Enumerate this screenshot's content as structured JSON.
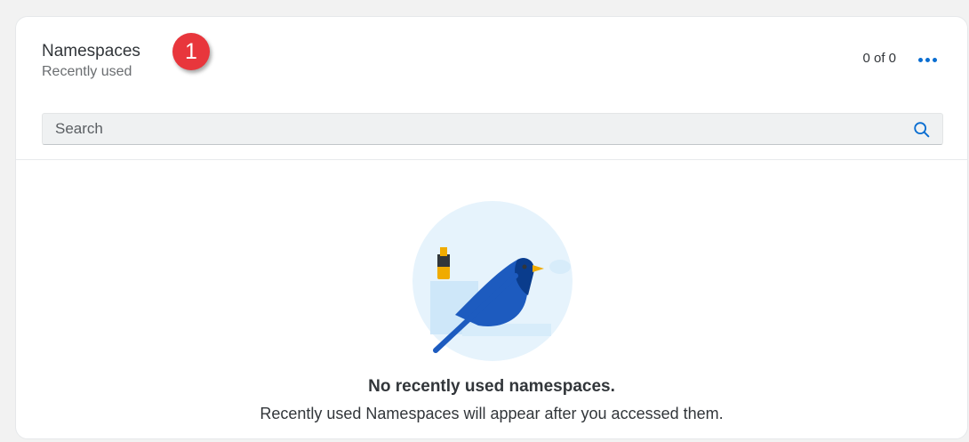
{
  "panel": {
    "title": "Namespaces",
    "subtitle": "Recently used",
    "step_badge": "1",
    "count": "0 of 0",
    "more_icon": "more-horizontal-icon"
  },
  "search": {
    "placeholder": "Search",
    "icon": "search-icon"
  },
  "empty_state": {
    "illustration": "bird-illustration",
    "title": "No recently used namespaces.",
    "description": "Recently used Namespaces will appear after you accessed them."
  },
  "colors": {
    "accent": "#0a6ed1",
    "badge": "#e8363c",
    "text": "#32363a"
  }
}
